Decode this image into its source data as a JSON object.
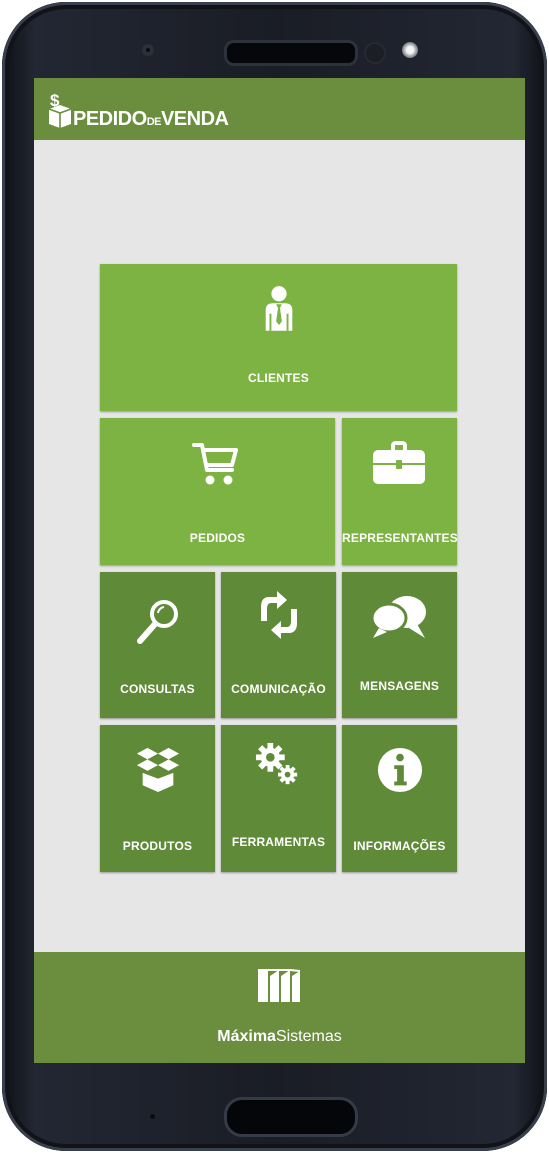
{
  "header": {
    "brand_part1": "PEDIDO",
    "brand_part2": "DE",
    "brand_part3": "VENDA",
    "logo_icon": "dollar-box-icon"
  },
  "menu": {
    "clientes": "CLIENTES",
    "pedidos": "PEDIDOS",
    "representantes": "REPRESENTANTES",
    "consultas": "CONSULTAS",
    "comunicacao": "COMUNICAÇÃO",
    "mensagens": "MENSAGENS",
    "produtos": "PRODUTOS",
    "ferramentas": "FERRAMENTAS",
    "informacoes": "INFORMAÇÕES"
  },
  "footer": {
    "company_bold": "Máxima",
    "company_regular": "Sistemas",
    "logo_icon": "maxima-logo-icon"
  },
  "colors": {
    "header_bg": "#6a8e3e",
    "tile_light": "#7cb342",
    "tile_dark": "#5f8a38",
    "screen_bg": "#e6e6e6"
  }
}
